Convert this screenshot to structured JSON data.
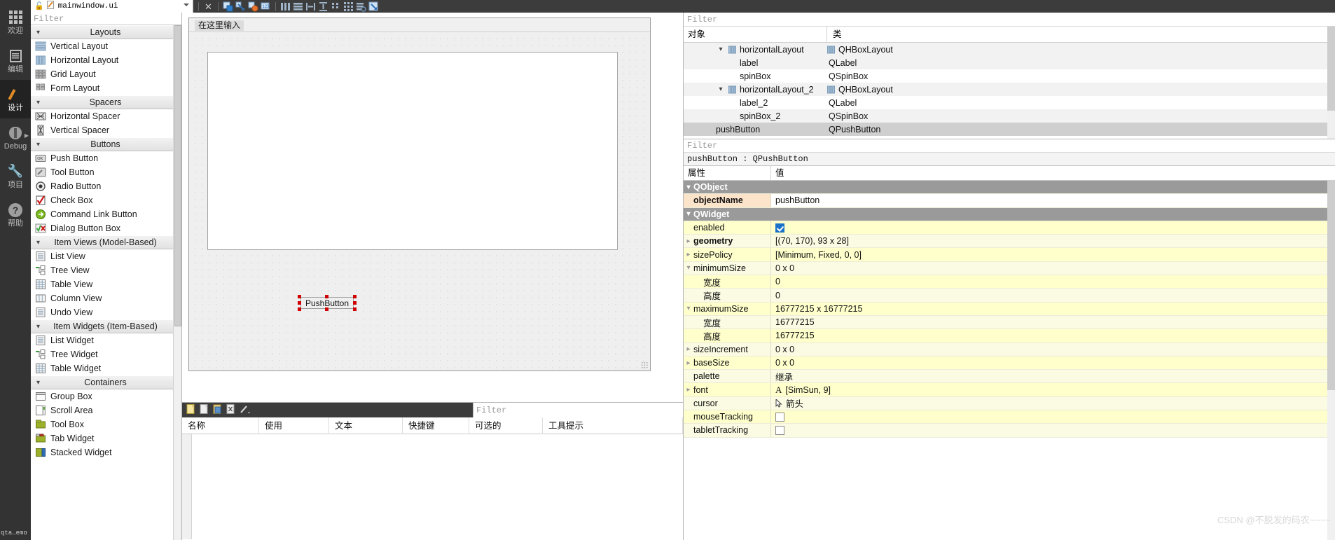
{
  "topbar": {
    "filename": "mainwindow.ui",
    "lock_icon": "lock-open-icon",
    "file_icon": "ui-file-icon",
    "dropdown_icon": "chevron-down-icon",
    "tools": [
      {
        "name": "close-icon",
        "glyph": "×"
      },
      {
        "name": "edit-widgets-icon"
      },
      {
        "name": "edit-signals-slots-icon"
      },
      {
        "name": "edit-buddies-icon"
      },
      {
        "name": "edit-tab-order-icon"
      },
      {
        "name": "layout-horizontally-icon"
      },
      {
        "name": "layout-vertically-icon"
      },
      {
        "name": "layout-in-splitter-horizontal-icon"
      },
      {
        "name": "layout-in-splitter-vertical-icon"
      },
      {
        "name": "layout-in-form-icon"
      },
      {
        "name": "layout-in-grid-icon"
      },
      {
        "name": "break-layout-icon"
      },
      {
        "name": "adjust-size-icon"
      }
    ]
  },
  "modebar": {
    "items": [
      {
        "label": "欢迎",
        "icon": "welcome-grid-icon",
        "active": false,
        "arrow": false
      },
      {
        "label": "编辑",
        "icon": "edit-lines-icon",
        "active": false,
        "arrow": false
      },
      {
        "label": "设计",
        "icon": "design-pencil-icon",
        "active": true,
        "arrow": false
      },
      {
        "label": "Debug",
        "icon": "debug-bug-icon",
        "active": false,
        "arrow": true
      },
      {
        "label": "项目",
        "icon": "projects-wrench-icon",
        "active": false,
        "arrow": false
      },
      {
        "label": "帮助",
        "icon": "help-question-icon",
        "active": false,
        "arrow": false
      }
    ],
    "bottom_text": "qta…emo"
  },
  "widget_box": {
    "filter_placeholder": "Filter",
    "sections": [
      {
        "title": "Layouts",
        "items": [
          {
            "label": "Vertical Layout",
            "icon": "vertical-layout-icon"
          },
          {
            "label": "Horizontal Layout",
            "icon": "horizontal-layout-icon"
          },
          {
            "label": "Grid Layout",
            "icon": "grid-layout-icon"
          },
          {
            "label": "Form Layout",
            "icon": "form-layout-icon"
          }
        ]
      },
      {
        "title": "Spacers",
        "items": [
          {
            "label": "Horizontal Spacer",
            "icon": "horizontal-spacer-icon"
          },
          {
            "label": "Vertical Spacer",
            "icon": "vertical-spacer-icon"
          }
        ]
      },
      {
        "title": "Buttons",
        "items": [
          {
            "label": "Push Button",
            "icon": "push-button-icon"
          },
          {
            "label": "Tool Button",
            "icon": "tool-button-icon"
          },
          {
            "label": "Radio Button",
            "icon": "radio-button-icon"
          },
          {
            "label": "Check Box",
            "icon": "check-box-icon"
          },
          {
            "label": "Command Link Button",
            "icon": "command-link-button-icon"
          },
          {
            "label": "Dialog Button Box",
            "icon": "dialog-button-box-icon"
          }
        ]
      },
      {
        "title": "Item Views (Model-Based)",
        "items": [
          {
            "label": "List View",
            "icon": "list-view-icon"
          },
          {
            "label": "Tree View",
            "icon": "tree-view-icon"
          },
          {
            "label": "Table View",
            "icon": "table-view-icon"
          },
          {
            "label": "Column View",
            "icon": "column-view-icon"
          },
          {
            "label": "Undo View",
            "icon": "undo-view-icon"
          }
        ]
      },
      {
        "title": "Item Widgets (Item-Based)",
        "items": [
          {
            "label": "List Widget",
            "icon": "list-widget-icon"
          },
          {
            "label": "Tree Widget",
            "icon": "tree-widget-icon"
          },
          {
            "label": "Table Widget",
            "icon": "table-widget-icon"
          }
        ]
      },
      {
        "title": "Containers",
        "items": [
          {
            "label": "Group Box",
            "icon": "group-box-icon"
          },
          {
            "label": "Scroll Area",
            "icon": "scroll-area-icon"
          },
          {
            "label": "Tool Box",
            "icon": "tool-box-icon"
          },
          {
            "label": "Tab Widget",
            "icon": "tab-widget-icon"
          },
          {
            "label": "Stacked Widget",
            "icon": "stacked-widget-icon"
          }
        ]
      }
    ]
  },
  "form": {
    "menu_placeholder": "在这里输入",
    "pushbutton_text": "PushButton"
  },
  "action_editor": {
    "filter_placeholder": "Filter",
    "toolbar_icons": [
      "new-action-icon",
      "copy-action-icon",
      "paste-action-icon",
      "delete-action-icon",
      "edit-action-icon"
    ],
    "columns": [
      "名称",
      "使用",
      "文本",
      "快捷键",
      "可选的",
      "工具提示"
    ],
    "rows": []
  },
  "object_inspector": {
    "filter_placeholder": "Filter",
    "columns": [
      "对象",
      "类"
    ],
    "rows": [
      {
        "name": "horizontalLayout",
        "cls": "QHBoxLayout",
        "indent": 1,
        "expandable": true,
        "icon": "hbox-layout-icon",
        "selected": false,
        "alt": true
      },
      {
        "name": "label",
        "cls": "QLabel",
        "indent": 2,
        "expandable": false,
        "icon": "",
        "selected": false,
        "alt": true
      },
      {
        "name": "spinBox",
        "cls": "QSpinBox",
        "indent": 2,
        "expandable": false,
        "icon": "",
        "selected": false,
        "alt": false
      },
      {
        "name": "horizontalLayout_2",
        "cls": "QHBoxLayout",
        "indent": 1,
        "expandable": true,
        "icon": "hbox-layout-icon",
        "selected": false,
        "alt": true
      },
      {
        "name": "label_2",
        "cls": "QLabel",
        "indent": 2,
        "expandable": false,
        "icon": "",
        "selected": false,
        "alt": false
      },
      {
        "name": "spinBox_2",
        "cls": "QSpinBox",
        "indent": 2,
        "expandable": false,
        "icon": "",
        "selected": false,
        "alt": true
      },
      {
        "name": "pushButton",
        "cls": "QPushButton",
        "indent": 1,
        "expandable": false,
        "icon": "",
        "selected": true,
        "alt": false
      }
    ]
  },
  "property_editor": {
    "filter_placeholder": "Filter",
    "add_icon": "plus-icon",
    "remove_icon": "minus-icon",
    "config_icon": "configure-icon",
    "object_header": "pushButton : QPushButton",
    "columns": [
      "属性",
      "值"
    ],
    "rows": [
      {
        "kind": "group",
        "key": "QObject",
        "value": "",
        "expanded": true
      },
      {
        "kind": "prop",
        "key": "objectName",
        "value": "pushButton",
        "indent": 1,
        "bold": true,
        "style": "objname"
      },
      {
        "kind": "group",
        "key": "QWidget",
        "value": "",
        "expanded": true
      },
      {
        "kind": "prop",
        "key": "enabled",
        "value": "",
        "indent": 1,
        "checkbox": "checked"
      },
      {
        "kind": "prop",
        "key": "geometry",
        "value": "[(70, 170), 93 x 28]",
        "indent": 1,
        "bold": true,
        "expandable": true
      },
      {
        "kind": "prop",
        "key": "sizePolicy",
        "value": "[Minimum, Fixed, 0, 0]",
        "indent": 1,
        "expandable": true
      },
      {
        "kind": "prop",
        "key": "minimumSize",
        "value": "0 x 0",
        "indent": 1,
        "expanded": true
      },
      {
        "kind": "prop",
        "key": "宽度",
        "value": "0",
        "indent": 2
      },
      {
        "kind": "prop",
        "key": "高度",
        "value": "0",
        "indent": 2
      },
      {
        "kind": "prop",
        "key": "maximumSize",
        "value": "16777215 x 16777215",
        "indent": 1,
        "expanded": true
      },
      {
        "kind": "prop",
        "key": "宽度",
        "value": "16777215",
        "indent": 2
      },
      {
        "kind": "prop",
        "key": "高度",
        "value": "16777215",
        "indent": 2
      },
      {
        "kind": "prop",
        "key": "sizeIncrement",
        "value": "0 x 0",
        "indent": 1,
        "expandable": true
      },
      {
        "kind": "prop",
        "key": "baseSize",
        "value": "0 x 0",
        "indent": 1,
        "expandable": true
      },
      {
        "kind": "prop",
        "key": "palette",
        "value": "继承",
        "indent": 1
      },
      {
        "kind": "prop",
        "key": "font",
        "value": "[SimSun, 9]",
        "indent": 1,
        "expandable": true,
        "icon": "font-A-icon"
      },
      {
        "kind": "prop",
        "key": "cursor",
        "value": "箭头",
        "indent": 1,
        "icon": "cursor-arrow-icon"
      },
      {
        "kind": "prop",
        "key": "mouseTracking",
        "value": "",
        "indent": 1,
        "checkbox": "unchecked"
      },
      {
        "kind": "prop",
        "key": "tabletTracking",
        "value": "",
        "indent": 1,
        "checkbox": "unchecked"
      }
    ]
  },
  "watermark": "CSDN @不脱发的码农~~~~"
}
